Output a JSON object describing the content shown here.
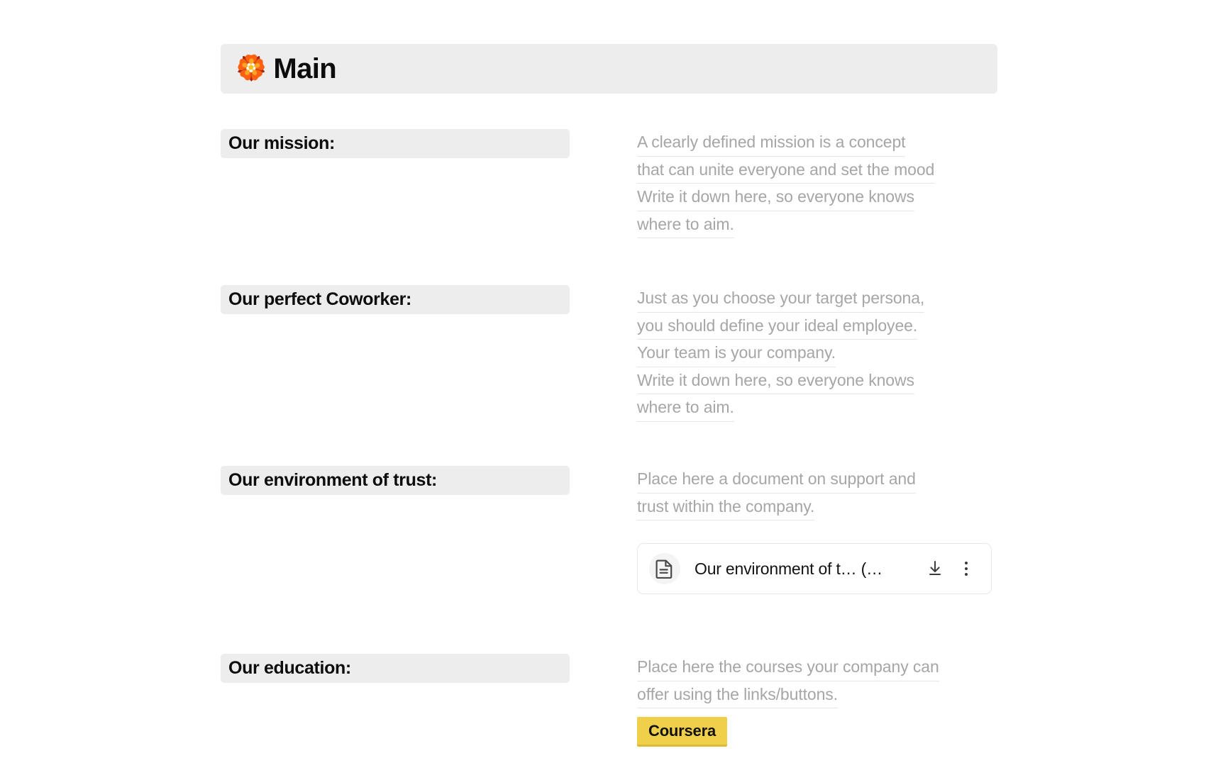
{
  "header": {
    "emoji": "🏵️",
    "emoji_name": "rosette-emoji",
    "title": "Main"
  },
  "sections": [
    {
      "id": "mission",
      "label": "Our mission:",
      "hint_lines": [
        "A clearly defined mission is a concept",
        "that can unite everyone and set the mood",
        "Write it down here, so everyone knows",
        "where to aim."
      ]
    },
    {
      "id": "coworker",
      "label": "Our perfect Coworker:",
      "hint_lines": [
        "Just as you choose your target persona,",
        "you should define your ideal employee.",
        "Your team is your company.",
        "Write it down here, so everyone knows",
        "where to aim."
      ]
    },
    {
      "id": "trust",
      "label": "Our environment of trust:",
      "hint_lines": [
        "Place here a document on support and",
        "trust within the company."
      ],
      "file": {
        "name": "Our environment of t…  (…",
        "file_icon": "document-icon",
        "download_icon": "download-icon",
        "menu_icon": "more-options-icon"
      }
    },
    {
      "id": "education",
      "label": "Our education:",
      "hint_lines": [
        "Place here the courses your company can",
        "offer using the links/buttons."
      ],
      "link_button": {
        "label": "Coursera",
        "color": "#f0cf4b"
      }
    }
  ],
  "colors": {
    "label_background": "#ededed",
    "hint_text": "#a6a6a6",
    "accent_button": "#f0cf4b",
    "page_background": "#ffffff"
  }
}
